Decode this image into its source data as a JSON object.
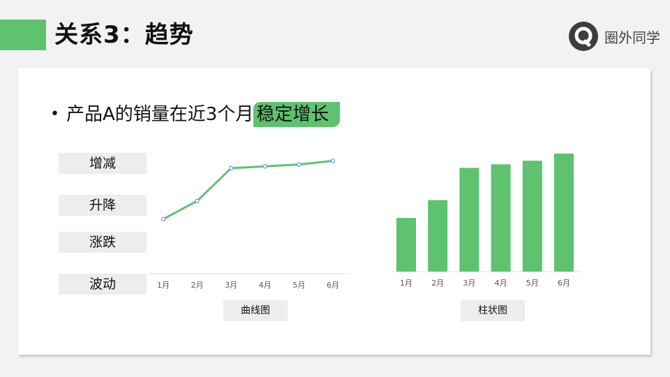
{
  "slide": {
    "title": "关系3：趋势",
    "bullet": "产品A的销量在近3个月",
    "highlight": "稳定增长"
  },
  "logo": {
    "text": "圈外同学",
    "icon": "q-logo-icon"
  },
  "tags": [
    "增减",
    "升降",
    "涨跌",
    "波动"
  ],
  "captions": {
    "line": "曲线图",
    "bar": "柱状图"
  },
  "colors": {
    "accent": "#5ec26f",
    "marker": "#6b8fd8"
  },
  "chart_data": [
    {
      "type": "line",
      "categories": [
        "1月",
        "2月",
        "3月",
        "4月",
        "5月",
        "6月"
      ],
      "values": [
        15,
        20,
        29,
        29.5,
        30,
        31
      ],
      "ylim": [
        0,
        33
      ],
      "title": "",
      "xlabel": "",
      "ylabel": ""
    },
    {
      "type": "bar",
      "categories": [
        "1月",
        "2月",
        "3月",
        "4月",
        "5月",
        "6月"
      ],
      "values": [
        15,
        20,
        29,
        30,
        31,
        33
      ],
      "ylim": [
        0,
        33
      ],
      "title": "",
      "xlabel": "",
      "ylabel": ""
    }
  ]
}
